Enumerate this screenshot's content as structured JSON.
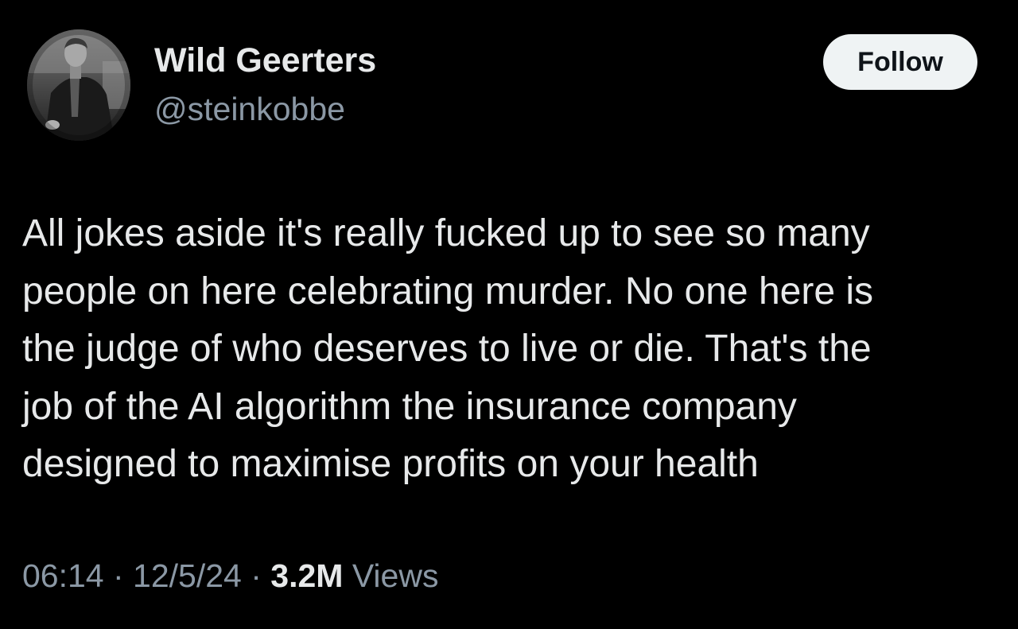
{
  "author": {
    "display_name": "Wild Geerters",
    "handle": "@steinkobbe",
    "avatar_icon": "vintage-portrait-photo"
  },
  "follow_button": {
    "label": "Follow"
  },
  "tweet": {
    "lines": [
      "All jokes aside it's really fucked up to see so many",
      "people on here celebrating murder. No one here is",
      "the judge of who deserves to live or die. That's the",
      "job of the AI algorithm the insurance company",
      "designed to maximise profits on your health"
    ]
  },
  "meta": {
    "time": "06:14",
    "separator": " · ",
    "date": "12/5/24",
    "views_count": "3.2M",
    "views_label": " Views"
  },
  "colors": {
    "background": "#000000",
    "primary_text": "#e7e9ea",
    "secondary_text": "#8b98a5",
    "button_bg": "#eff3f4",
    "button_text": "#0f1419"
  }
}
